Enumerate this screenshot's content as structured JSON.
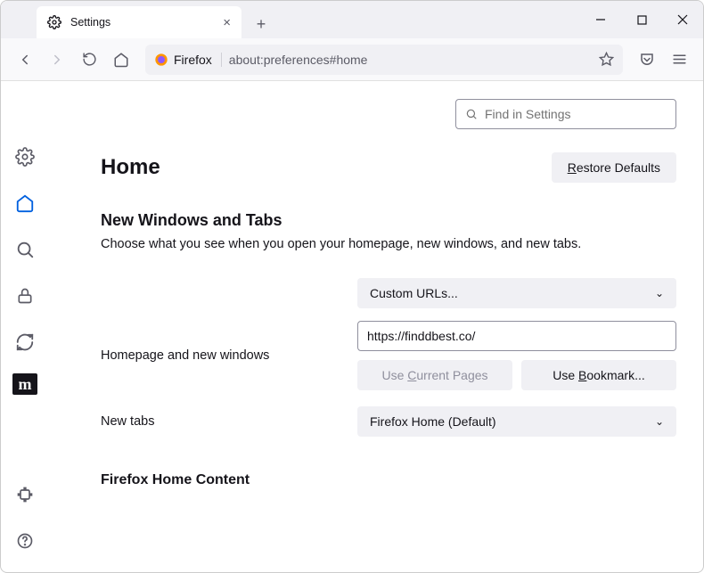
{
  "tab": {
    "title": "Settings"
  },
  "url": {
    "identity": "Firefox",
    "address": "about:preferences#home"
  },
  "search": {
    "placeholder": "Find in Settings"
  },
  "page": {
    "title": "Home",
    "restore": "Restore Defaults",
    "section_title": "New Windows and Tabs",
    "section_desc": "Choose what you see when you open your homepage, new windows, and new tabs.",
    "homepage_label": "Homepage and new windows",
    "homepage_select": "Custom URLs...",
    "homepage_url": "https://finddbest.co/",
    "use_current": "Use Current Pages",
    "use_bookmark": "Use Bookmark...",
    "newtabs_label": "New tabs",
    "newtabs_select": "Firefox Home (Default)",
    "firefox_home_content": "Firefox Home Content"
  }
}
